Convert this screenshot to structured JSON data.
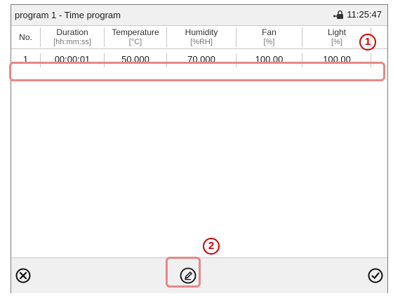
{
  "window": {
    "title": "program 1 - Time program",
    "time": "11:25:47"
  },
  "table": {
    "headers": [
      {
        "label": "No.",
        "unit": ""
      },
      {
        "label": "Duration",
        "unit": "[hh:mm:ss]"
      },
      {
        "label": "Temperature",
        "unit": "[°C]"
      },
      {
        "label": "Humidity",
        "unit": "[%RH]"
      },
      {
        "label": "Fan",
        "unit": "[%]"
      },
      {
        "label": "Light",
        "unit": "[%]"
      }
    ],
    "rows": [
      {
        "no": "1",
        "duration": "00:00:01",
        "temperature": "50.000",
        "humidity": "70.000",
        "fan": "100.00",
        "light": "100.00"
      }
    ]
  },
  "markers": {
    "one": "1",
    "two": "2"
  },
  "icons": {
    "cancel": "close-circle-icon",
    "edit": "pencil-icon",
    "confirm": "checkmark-circle-icon",
    "lock": "lock-icon"
  },
  "colors": {
    "highlight": "#e58989",
    "marker": "#d40000"
  }
}
